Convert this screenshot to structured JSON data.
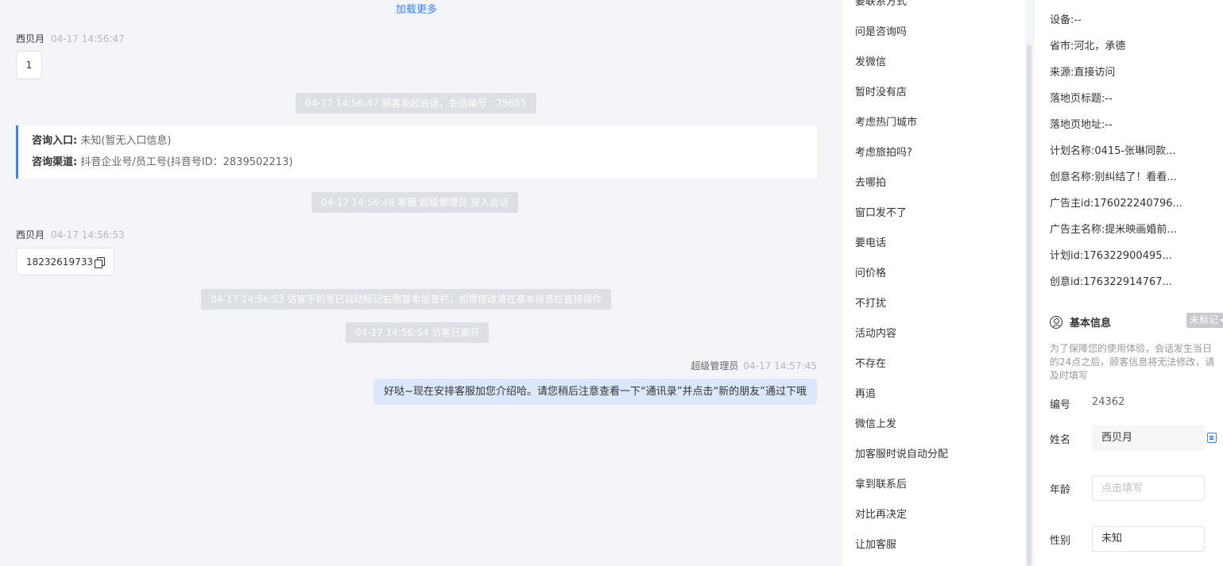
{
  "chat": {
    "load_more": "加载更多",
    "messages": [
      {
        "sender": "西贝月",
        "time": "04-17 14:56:47",
        "text": "1"
      },
      {
        "sender": "西贝月",
        "time": "04-17 14:56:53",
        "text": "18232619733"
      }
    ],
    "system": [
      "04-17 14:56:47 顾客发起会话，会话编号：25655",
      "04-17 14:56:48 客服 超级管理员 接入会话",
      "04-17 14:56:53 访客手机号已自动标记右侧基本信息栏，如需修改请在基本信息栏直接操作",
      "04-17 14:56:54 访客已离开"
    ],
    "info_card": {
      "entry_label": "咨询入口:",
      "entry_value": "未知(暂无入口信息)",
      "channel_label": "咨询渠道:",
      "channel_value": "抖音企业号/员工号(抖音号ID：2839502213)"
    },
    "agent_message": {
      "sender": "超级管理员",
      "time": "04-17 14:57:45",
      "text": "好哒~现在安排客服加您介绍哈。请您稍后注意查看一下“通讯录”并点击“新的朋友”通过下哦"
    }
  },
  "quick_replies": [
    "要联系方式",
    "问是咨询吗",
    "发微信",
    "暂时没有店",
    "考虑热门城市",
    "考虑旅拍吗?",
    "去哪拍",
    "窗口发不了",
    "要电话",
    "问价格",
    "不打扰",
    "活动内容",
    "不存在",
    "再追",
    "微信上发",
    "加客服时说自动分配",
    "拿到联系后",
    "对比再决定",
    "让加客服"
  ],
  "visitor_info": [
    {
      "label": "设备:",
      "value": "--"
    },
    {
      "label": "省市:",
      "value": "河北，承德"
    },
    {
      "label": "来源:",
      "value": "直接访问"
    },
    {
      "label": "落地页标题:",
      "value": "--"
    },
    {
      "label": "落地页地址:",
      "value": "--"
    },
    {
      "label": "计划名称:",
      "value": "0415-张琳同款..."
    },
    {
      "label": "创意名称:",
      "value": "别纠结了！看看..."
    },
    {
      "label": "广告主id:",
      "value": "176022240796..."
    },
    {
      "label": "广告主名称:",
      "value": "提米映画婚前..."
    },
    {
      "label": "计划id:",
      "value": "176322900495..."
    },
    {
      "label": "创意id:",
      "value": "176322914767..."
    }
  ],
  "basic_info": {
    "title": "基本信息",
    "tag": "未标记",
    "notice": "为了保障您的使用体验，会话发生当日的24点之后，顾客信息将无法修改，请及时填写",
    "number_label": "编号",
    "number_value": "24362",
    "name_label": "姓名",
    "name_value": "西贝月",
    "age_label": "年龄",
    "age_placeholder": "点击填写",
    "gender_label": "性别",
    "gender_value": "未知"
  }
}
